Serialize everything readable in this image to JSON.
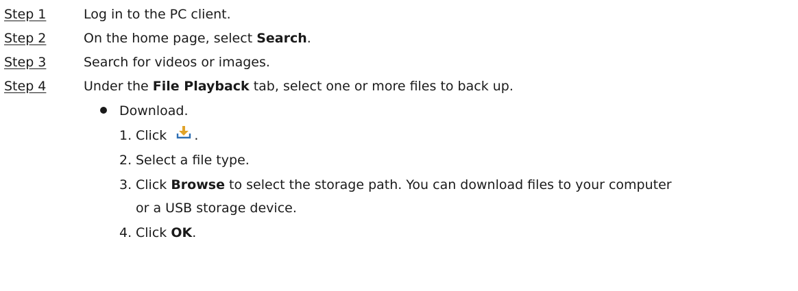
{
  "steps": [
    {
      "label": "Step 1",
      "text_before": "Log in to the PC client.",
      "bold": "",
      "text_after": ""
    },
    {
      "label": "Step 2",
      "text_before": "On the home page, select ",
      "bold": "Search",
      "text_after": "."
    },
    {
      "label": "Step 3",
      "text_before": "Search for videos or images.",
      "bold": "",
      "text_after": ""
    },
    {
      "label": "Step 4",
      "text_before": "Under the ",
      "bold": "File Playback",
      "text_after": " tab, select one or more files to back up."
    }
  ],
  "bullet": {
    "text": "Download."
  },
  "substeps": [
    {
      "num": "1.",
      "text_before": "Click ",
      "icon": "download-icon",
      "text_after": "."
    },
    {
      "num": "2.",
      "text_before": "Select a file type.",
      "bold": "",
      "text_after": ""
    },
    {
      "num": "3.",
      "text_before": "Click ",
      "bold": "Browse",
      "text_after": " to select the storage path. You can download files to your computer",
      "continuation": "or a USB storage device."
    },
    {
      "num": "4.",
      "text_before": "Click ",
      "bold": "OK",
      "text_after": "."
    }
  ],
  "colors": {
    "text": "#1a1a1a",
    "icon": "#e0a32a"
  }
}
